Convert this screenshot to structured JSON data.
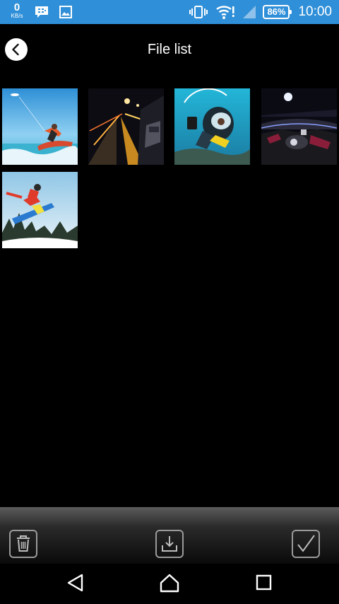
{
  "status_bar": {
    "net_speed_value": "0",
    "net_speed_unit": "KB/s",
    "battery": "86%",
    "time": "10:00",
    "background": "#2f8fd8",
    "icons": [
      "bbm-icon",
      "gallery-icon",
      "vibrate-icon",
      "wifi-alert-icon",
      "signal-icon",
      "battery-icon"
    ]
  },
  "header": {
    "title": "File list",
    "back_icon": "chevron-left-icon"
  },
  "files": [
    {
      "name": "kiteboarding-thumbnail",
      "subject": "kiteboarder jumping"
    },
    {
      "name": "night-road-thumbnail",
      "subject": "car on night road"
    },
    {
      "name": "diver-thumbnail",
      "subject": "scuba diver selfie"
    },
    {
      "name": "motorcycle-thumbnail",
      "subject": "motorcycle cockpit at night"
    },
    {
      "name": "snowboarder-thumbnail",
      "subject": "snowboarder jumping"
    }
  ],
  "toolbar": {
    "icons": [
      "trash-icon",
      "download-icon",
      "checkmark-icon"
    ]
  },
  "nav_bar": {
    "icons": [
      "back-triangle-icon",
      "home-icon",
      "recents-square-icon"
    ]
  }
}
